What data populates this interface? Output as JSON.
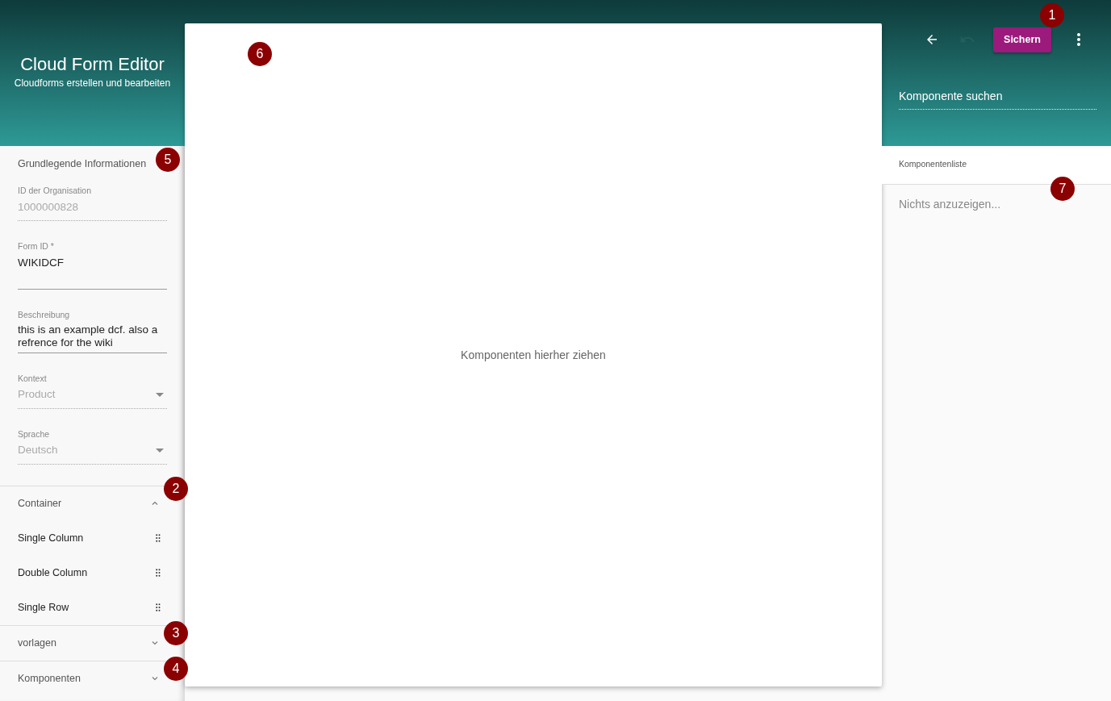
{
  "header": {
    "title": "Cloud Form Editor",
    "subtitle": "Cloudforms erstellen und bearbeiten"
  },
  "toolbar": {
    "actions": [
      {
        "kind": "back",
        "disabled": false
      },
      {
        "kind": "undo",
        "disabled": true
      },
      {
        "kind": "save",
        "label": "Sichern",
        "disabled": false,
        "marker": "1"
      },
      {
        "kind": "more",
        "disabled": false
      }
    ]
  },
  "search": {
    "placeholder": "Komponente suchen"
  },
  "basic_info": {
    "title": "Grundlegende Informationen",
    "marker": "5",
    "fields": [
      {
        "kind": "text",
        "label": "ID der Organisation",
        "value": "1000000828",
        "disabled": true
      },
      {
        "kind": "text",
        "label": "Form ID *",
        "value": "WIKIDCF",
        "disabled": false
      },
      {
        "kind": "textarea",
        "label": "Beschreibung",
        "value": "this is an example dcf. also a refrence for the wiki",
        "disabled": false
      },
      {
        "kind": "select",
        "label": "Kontext",
        "value": "Product",
        "disabled": true
      },
      {
        "kind": "select",
        "label": "Sprache",
        "value": "Deutsch",
        "disabled": true
      }
    ]
  },
  "panels": [
    {
      "title": "Container",
      "expanded": true,
      "marker": "2",
      "items": [
        "Single Column",
        "Double Column",
        "Single Row"
      ]
    },
    {
      "title": "vorlagen",
      "expanded": false,
      "marker": "3"
    },
    {
      "title": "Komponenten",
      "expanded": false,
      "marker": "4"
    }
  ],
  "canvas": {
    "placeholder": "Komponenten hierher ziehen",
    "marker": "6"
  },
  "component_list": {
    "title": "Komponentenliste",
    "empty_text": "Nichts anzuzeigen...",
    "marker": "7"
  }
}
